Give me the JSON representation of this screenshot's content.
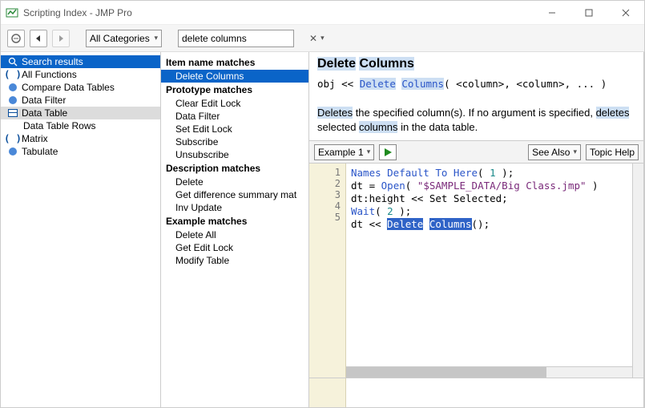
{
  "window": {
    "title": "Scripting Index - JMP Pro"
  },
  "toolbar": {
    "category_label": "All Categories",
    "search_value": "delete columns"
  },
  "tree": {
    "search_results": "Search results",
    "items": [
      "All Functions",
      "Compare Data Tables",
      "Data Filter",
      "Data Table",
      "Data Table Rows",
      "Matrix",
      "Tabulate"
    ]
  },
  "matches": {
    "g1": "Item name matches",
    "g1_items": [
      "Delete Columns"
    ],
    "g2": "Prototype matches",
    "g2_items": [
      "Clear Edit Lock",
      "Data Filter",
      "Set Edit Lock",
      "Subscribe",
      "Unsubscribe"
    ],
    "g3": "Description matches",
    "g3_items": [
      "Delete",
      "Get difference summary mat",
      "Inv Update"
    ],
    "g4": "Example matches",
    "g4_items": [
      "Delete All",
      "Get Edit Lock",
      "Modify Table"
    ]
  },
  "detail": {
    "title_a": "Delete",
    "title_b": "Columns",
    "sig_prefix": "obj << ",
    "sig_kw1": "Delete",
    "sig_kw2": "Columns",
    "sig_args": "( <column>, <column>, ... )",
    "desc_w1": "Deletes",
    "desc_mid": " the specified column(s). If no argument is specified, ",
    "desc_w2": "deletes",
    "desc_mid2": " selected ",
    "desc_w3": "columns",
    "desc_end": " in the data table."
  },
  "example": {
    "selector": "Example 1",
    "see_also": "See Also",
    "topic_help": "Topic Help",
    "lines": [
      "1",
      "2",
      "3",
      "4",
      "5"
    ],
    "l1a": "Names Default To Here",
    "l1b": "( ",
    "l1n": "1",
    "l1c": " );",
    "l2a": "dt = ",
    "l2b": "Open",
    "l2c": "( ",
    "l2s": "\"$SAMPLE_DATA/Big Class.jmp\"",
    "l2d": " )",
    "l3": "dt:height << Set Selected;",
    "l4a": "Wait",
    "l4b": "( ",
    "l4n": "2",
    "l4c": " );",
    "l5a": "dt << ",
    "l5s1": "Delete",
    "l5sp": " ",
    "l5s2": "Columns",
    "l5b": "();"
  }
}
